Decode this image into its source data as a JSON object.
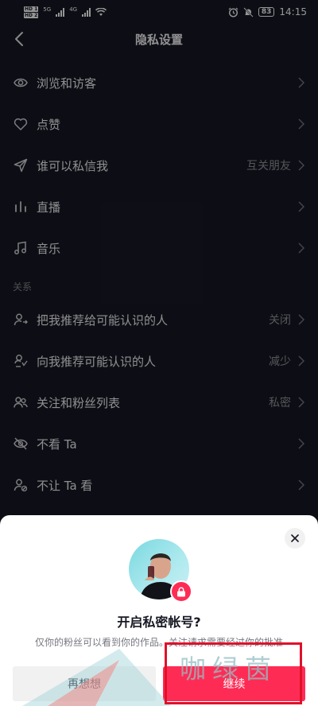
{
  "status_bar": {
    "hd1": "HD",
    "hd1_num": "1",
    "hd2": "HD",
    "hd2_num": "2",
    "net1": "5G",
    "net2": "4G",
    "battery": "83",
    "time": "14:15"
  },
  "nav": {
    "title": "隐私设置"
  },
  "rows_top": [
    {
      "label": "浏览和访客",
      "value": ""
    },
    {
      "label": "点赞",
      "value": ""
    },
    {
      "label": "谁可以私信我",
      "value": "互关朋友"
    },
    {
      "label": "直播",
      "value": ""
    },
    {
      "label": "音乐",
      "value": ""
    }
  ],
  "section_title": "关系",
  "rows_relation": [
    {
      "label": "把我推荐给可能认识的人",
      "value": "关闭"
    },
    {
      "label": "向我推荐可能认识的人",
      "value": "减少"
    },
    {
      "label": "关注和粉丝列表",
      "value": "私密"
    },
    {
      "label": "不看 Ta",
      "value": ""
    },
    {
      "label": "不让 Ta 看",
      "value": ""
    }
  ],
  "sheet": {
    "title": "开启私密帐号?",
    "description": "仅你的粉丝可以看到你的作品。关注请求需要经过你的批准",
    "cancel_label": "再想想",
    "continue_label": "继续"
  },
  "watermark": "咖绿茵",
  "colors": {
    "background": "#161823",
    "accent": "#fe2c55",
    "sheet": "#ffffff"
  },
  "icons": {
    "rows_top": [
      "eye-icon",
      "heart-icon",
      "send-icon",
      "live-bars-icon",
      "music-note-icon"
    ],
    "rows_relation": [
      "person-share-icon",
      "person-recommend-icon",
      "people-icon",
      "eye-off-icon",
      "person-block-icon"
    ]
  }
}
